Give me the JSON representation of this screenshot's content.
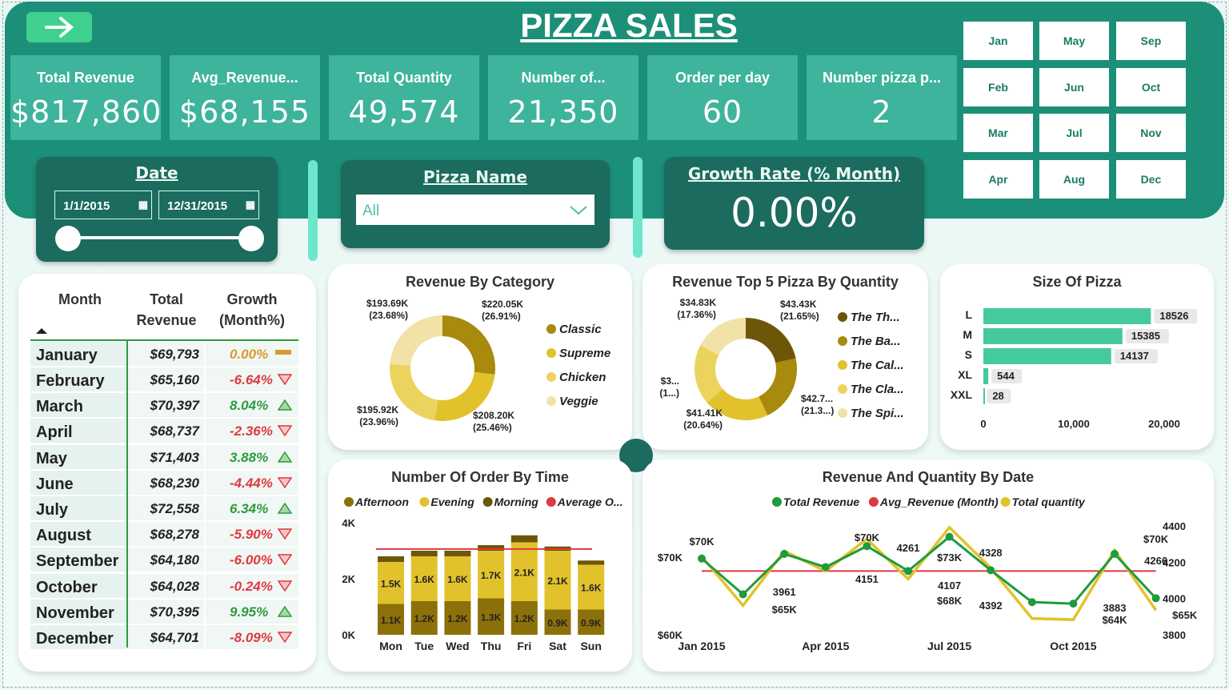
{
  "title": "PIZZA SALES",
  "kpis": [
    {
      "label": "Total Revenue",
      "value": "$817,860"
    },
    {
      "label": "Avg_Revenue...",
      "value": "$68,155"
    },
    {
      "label": "Total Quantity",
      "value": "49,574"
    },
    {
      "label": "Number of...",
      "value": "21,350"
    },
    {
      "label": "Order per day",
      "value": "60"
    },
    {
      "label": "Number pizza p...",
      "value": "2"
    }
  ],
  "months": [
    "Jan",
    "May",
    "Sep",
    "Feb",
    "Jun",
    "Oct",
    "Mar",
    "Jul",
    "Nov",
    "Apr",
    "Aug",
    "Dec"
  ],
  "date": {
    "title": "Date",
    "start": "1/1/2015",
    "end": "12/31/2015"
  },
  "pizza_name": {
    "title": "Pizza Name",
    "value": "All"
  },
  "growth": {
    "title": "Growth Rate (% Month)",
    "value": "0.00%"
  },
  "table": {
    "headers": [
      "Month",
      "Total Revenue",
      "Growth (Month%)"
    ],
    "rows": [
      {
        "m": "January",
        "r": "$69,793",
        "g": "0.00%",
        "t": "flat"
      },
      {
        "m": "February",
        "r": "$65,160",
        "g": "-6.64%",
        "t": "down"
      },
      {
        "m": "March",
        "r": "$70,397",
        "g": "8.04%",
        "t": "up"
      },
      {
        "m": "April",
        "r": "$68,737",
        "g": "-2.36%",
        "t": "down"
      },
      {
        "m": "May",
        "r": "$71,403",
        "g": "3.88%",
        "t": "up"
      },
      {
        "m": "June",
        "r": "$68,230",
        "g": "-4.44%",
        "t": "down"
      },
      {
        "m": "July",
        "r": "$72,558",
        "g": "6.34%",
        "t": "up"
      },
      {
        "m": "August",
        "r": "$68,278",
        "g": "-5.90%",
        "t": "down"
      },
      {
        "m": "September",
        "r": "$64,180",
        "g": "-6.00%",
        "t": "down"
      },
      {
        "m": "October",
        "r": "$64,028",
        "g": "-0.24%",
        "t": "down"
      },
      {
        "m": "November",
        "r": "$70,395",
        "g": "9.95%",
        "t": "up"
      },
      {
        "m": "December",
        "r": "$64,701",
        "g": "-8.09%",
        "t": "down"
      }
    ]
  },
  "colors": {
    "header": "#1c8f78",
    "kpi": "#3db49b",
    "up": "#2e9a3f",
    "down": "#e0393e",
    "flat": "#d99a2a"
  },
  "chart_data": [
    {
      "type": "pie",
      "title": "Revenue By Category",
      "slices": [
        {
          "name": "Classic",
          "value": 220.05,
          "label": "$220.05K",
          "pct": "(26.91%)",
          "color": "#a88a0c"
        },
        {
          "name": "Supreme",
          "value": 208.2,
          "label": "$208.20K",
          "pct": "(25.46%)",
          "color": "#e2c22c"
        },
        {
          "name": "Chicken",
          "value": 195.92,
          "label": "$195.92K",
          "pct": "(23.96%)",
          "color": "#ecd35e"
        },
        {
          "name": "Veggie",
          "value": 193.69,
          "label": "$193.69K",
          "pct": "(23.68%)",
          "color": "#f1e2a8"
        }
      ]
    },
    {
      "type": "pie",
      "title": "Revenue Top 5 Pizza By Quantity",
      "slices": [
        {
          "name": "The Th...",
          "value": 43.43,
          "label": "$43.43K",
          "pct": "(21.65%)",
          "color": "#6e5608"
        },
        {
          "name": "The Ba...",
          "value": 42.7,
          "label": "$42.7...",
          "pct": "(21.3...)",
          "color": "#a88a0c"
        },
        {
          "name": "The Cal...",
          "value": 41.41,
          "label": "$41.41K",
          "pct": "(20.64%)",
          "color": "#e2c22c"
        },
        {
          "name": "The Cla...",
          "value": 38.0,
          "label": "$3...",
          "pct": "(1...)",
          "color": "#ecd35e"
        },
        {
          "name": "The Spi...",
          "value": 34.83,
          "label": "$34.83K",
          "pct": "(17.36%)",
          "color": "#f1e2a8"
        }
      ]
    },
    {
      "type": "bar",
      "title": "Size Of Pizza",
      "categories": [
        "L",
        "M",
        "S",
        "XL",
        "XXL"
      ],
      "values": [
        18526,
        15385,
        14137,
        544,
        28
      ],
      "ticks": [
        "0",
        "10,000",
        "20,000"
      ],
      "xlim": [
        0,
        20000
      ],
      "color": "#45c99f"
    },
    {
      "type": "bar",
      "title": "Number Of Order By Time",
      "categories": [
        "Mon",
        "Tue",
        "Wed",
        "Thu",
        "Fri",
        "Sat",
        "Sun"
      ],
      "series": [
        {
          "name": "Afternoon",
          "color": "#8c7009",
          "values": [
            1.1,
            1.2,
            1.2,
            1.3,
            1.2,
            0.9,
            0.9
          ],
          "labels": [
            "1.1K",
            "1.2K",
            "1.2K",
            "1.3K",
            "1.2K",
            "0.9K",
            "0.9K"
          ]
        },
        {
          "name": "Evening",
          "color": "#e2c22c",
          "values": [
            1.5,
            1.6,
            1.6,
            1.7,
            2.1,
            2.1,
            1.6
          ],
          "labels": [
            "1.5K",
            "1.6K",
            "1.6K",
            "1.7K",
            "2.1K",
            "2.1K",
            "1.6K"
          ]
        },
        {
          "name": "Morning",
          "color": "#6e5608",
          "values": [
            0.2,
            0.2,
            0.2,
            0.2,
            0.25,
            0.15,
            0.15
          ]
        }
      ],
      "average": {
        "name": "Average O...",
        "value": 3.06,
        "color": "#e0393e"
      },
      "ylim": [
        0,
        4
      ],
      "yticks": [
        "0K",
        "2K",
        "4K"
      ]
    },
    {
      "type": "line",
      "title": "Revenue And Quantity By Date",
      "x": [
        "Jan",
        "Feb",
        "Mar",
        "Apr",
        "May",
        "Jun",
        "Jul",
        "Aug",
        "Sep",
        "Oct",
        "Nov",
        "Dec"
      ],
      "xticks": [
        "Jan 2015",
        "Apr 2015",
        "Jul 2015",
        "Oct 2015"
      ],
      "series": [
        {
          "name": "Total Revenue",
          "color": "#1e9b3c",
          "values": [
            69.8,
            65.2,
            70.4,
            68.7,
            71.4,
            68.2,
            72.6,
            68.3,
            64.2,
            64.0,
            70.4,
            64.7
          ]
        },
        {
          "name": "Avg_Revenue (Month)",
          "color": "#e0393e",
          "value": 68.2
        },
        {
          "name": "Total quantity",
          "color": "#e2c22c",
          "values": [
            4232,
            3961,
            4261,
            4151,
            4328,
            4107,
            4392,
            4168,
            3890,
            3883,
            4266,
            3935
          ]
        }
      ],
      "ylim_left": [
        60,
        74
      ],
      "ylim_right": [
        3800,
        4400
      ],
      "yticks_left": [
        "$60K",
        "$70K"
      ],
      "yticks_right": [
        "3800",
        "4000",
        "4200",
        "4400"
      ],
      "annotations": [
        "$70K",
        "3961",
        "$65K",
        "$70K",
        "4261",
        "4151",
        "4328",
        "$68K",
        "4107",
        "4392",
        "$73K",
        "3883",
        "$64K",
        "$70K",
        "4266",
        "$65K"
      ]
    }
  ]
}
